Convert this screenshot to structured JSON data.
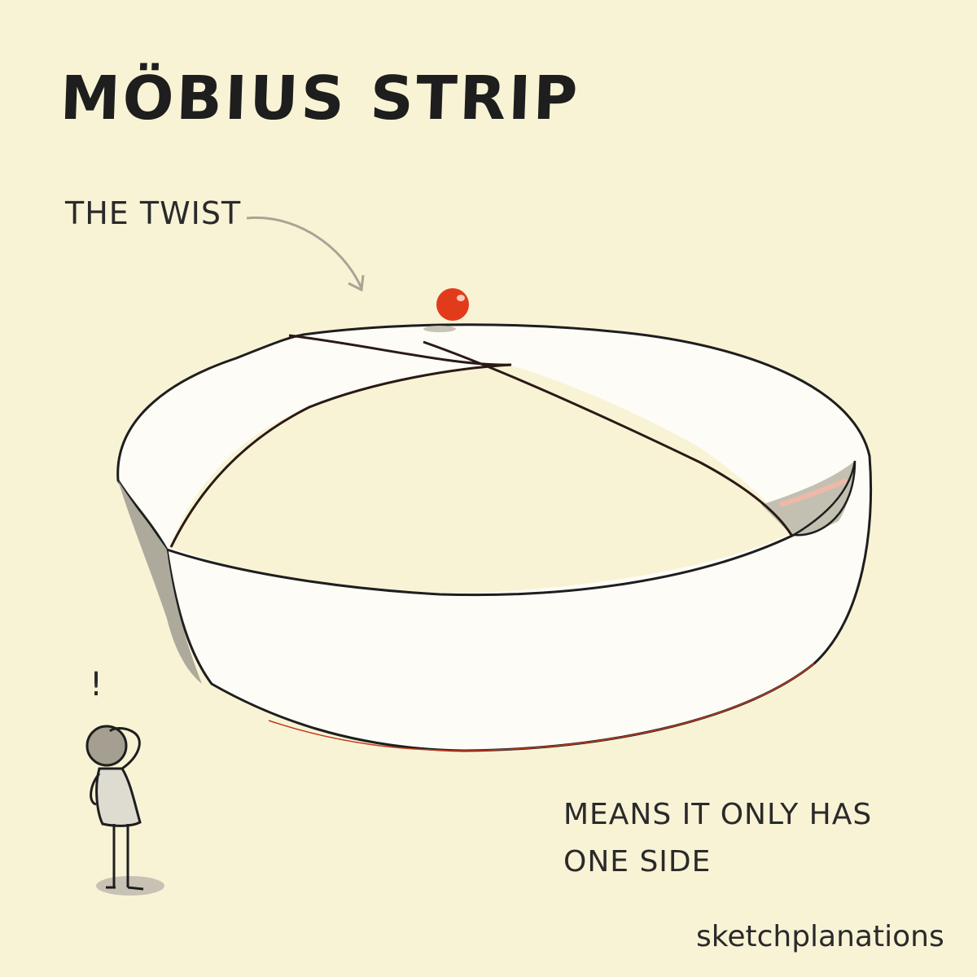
{
  "title": "MÖBIUS STRIP",
  "labels": {
    "twist": "THE TWIST",
    "exclaim": "!",
    "caption_line1": "MEANS IT ONLY HAS",
    "caption_line2": "ONE SIDE",
    "brand": "sketchplanations"
  },
  "colors": {
    "background": "#f9f3d6",
    "strip": "#fdfcf7",
    "shadow": "#bdb9a9",
    "ball": "#e23b1c",
    "ink": "#222222",
    "arrow": "#a8a594"
  },
  "icons": {
    "ball": "red-ball-icon",
    "person": "person-icon",
    "arrow": "curved-arrow-icon"
  }
}
